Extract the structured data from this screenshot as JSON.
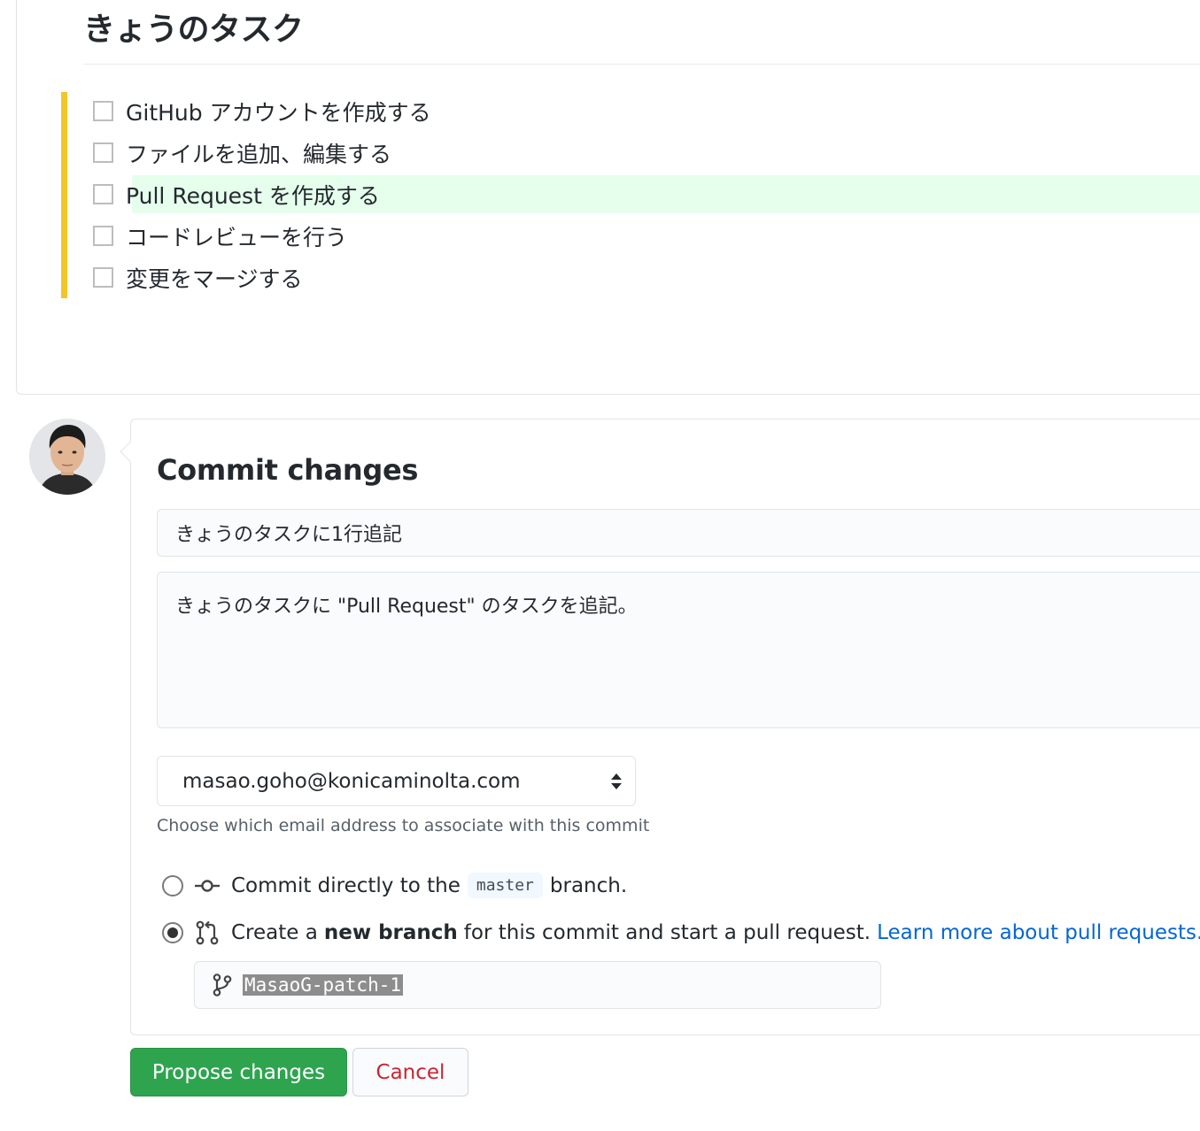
{
  "preview": {
    "heading": "きょうのタスク",
    "tasks": [
      {
        "label": "GitHub アカウントを作成する",
        "added": false
      },
      {
        "label": "ファイルを追加、編集する",
        "added": false
      },
      {
        "label": "Pull Request を作成する",
        "added": true
      },
      {
        "label": "コードレビューを行う",
        "added": false
      },
      {
        "label": "変更をマージする",
        "added": false
      }
    ]
  },
  "commit": {
    "title": "Commit changes",
    "summary_value": "きょうのタスクに1行追記",
    "description_value": "きょうのタスクに \"Pull Request\" のタスクを追記。",
    "email": "masao.goho@konicaminolta.com",
    "email_note": "Choose which email address to associate with this commit",
    "option_direct": {
      "prefix": "Commit directly to the",
      "branch": "master",
      "suffix": "branch.",
      "selected": false
    },
    "option_new_branch": {
      "prefix": "Create a",
      "bold": "new branch",
      "suffix": "for this commit and start a pull request.",
      "link": "Learn more about pull requests.",
      "selected": true
    },
    "new_branch_name": "MasaoG-patch-1"
  },
  "buttons": {
    "propose": "Propose changes",
    "cancel": "Cancel"
  },
  "colors": {
    "change_bar": "#f2c627",
    "added_line": "#e6ffed",
    "primary_button": "#2ea44f",
    "cancel_text": "#cb2431",
    "link": "#0366d6"
  },
  "icons": {
    "commit": "git-commit-icon",
    "pull_request": "git-pull-request-icon",
    "branch": "git-branch-icon",
    "select": "select-arrows-icon"
  }
}
